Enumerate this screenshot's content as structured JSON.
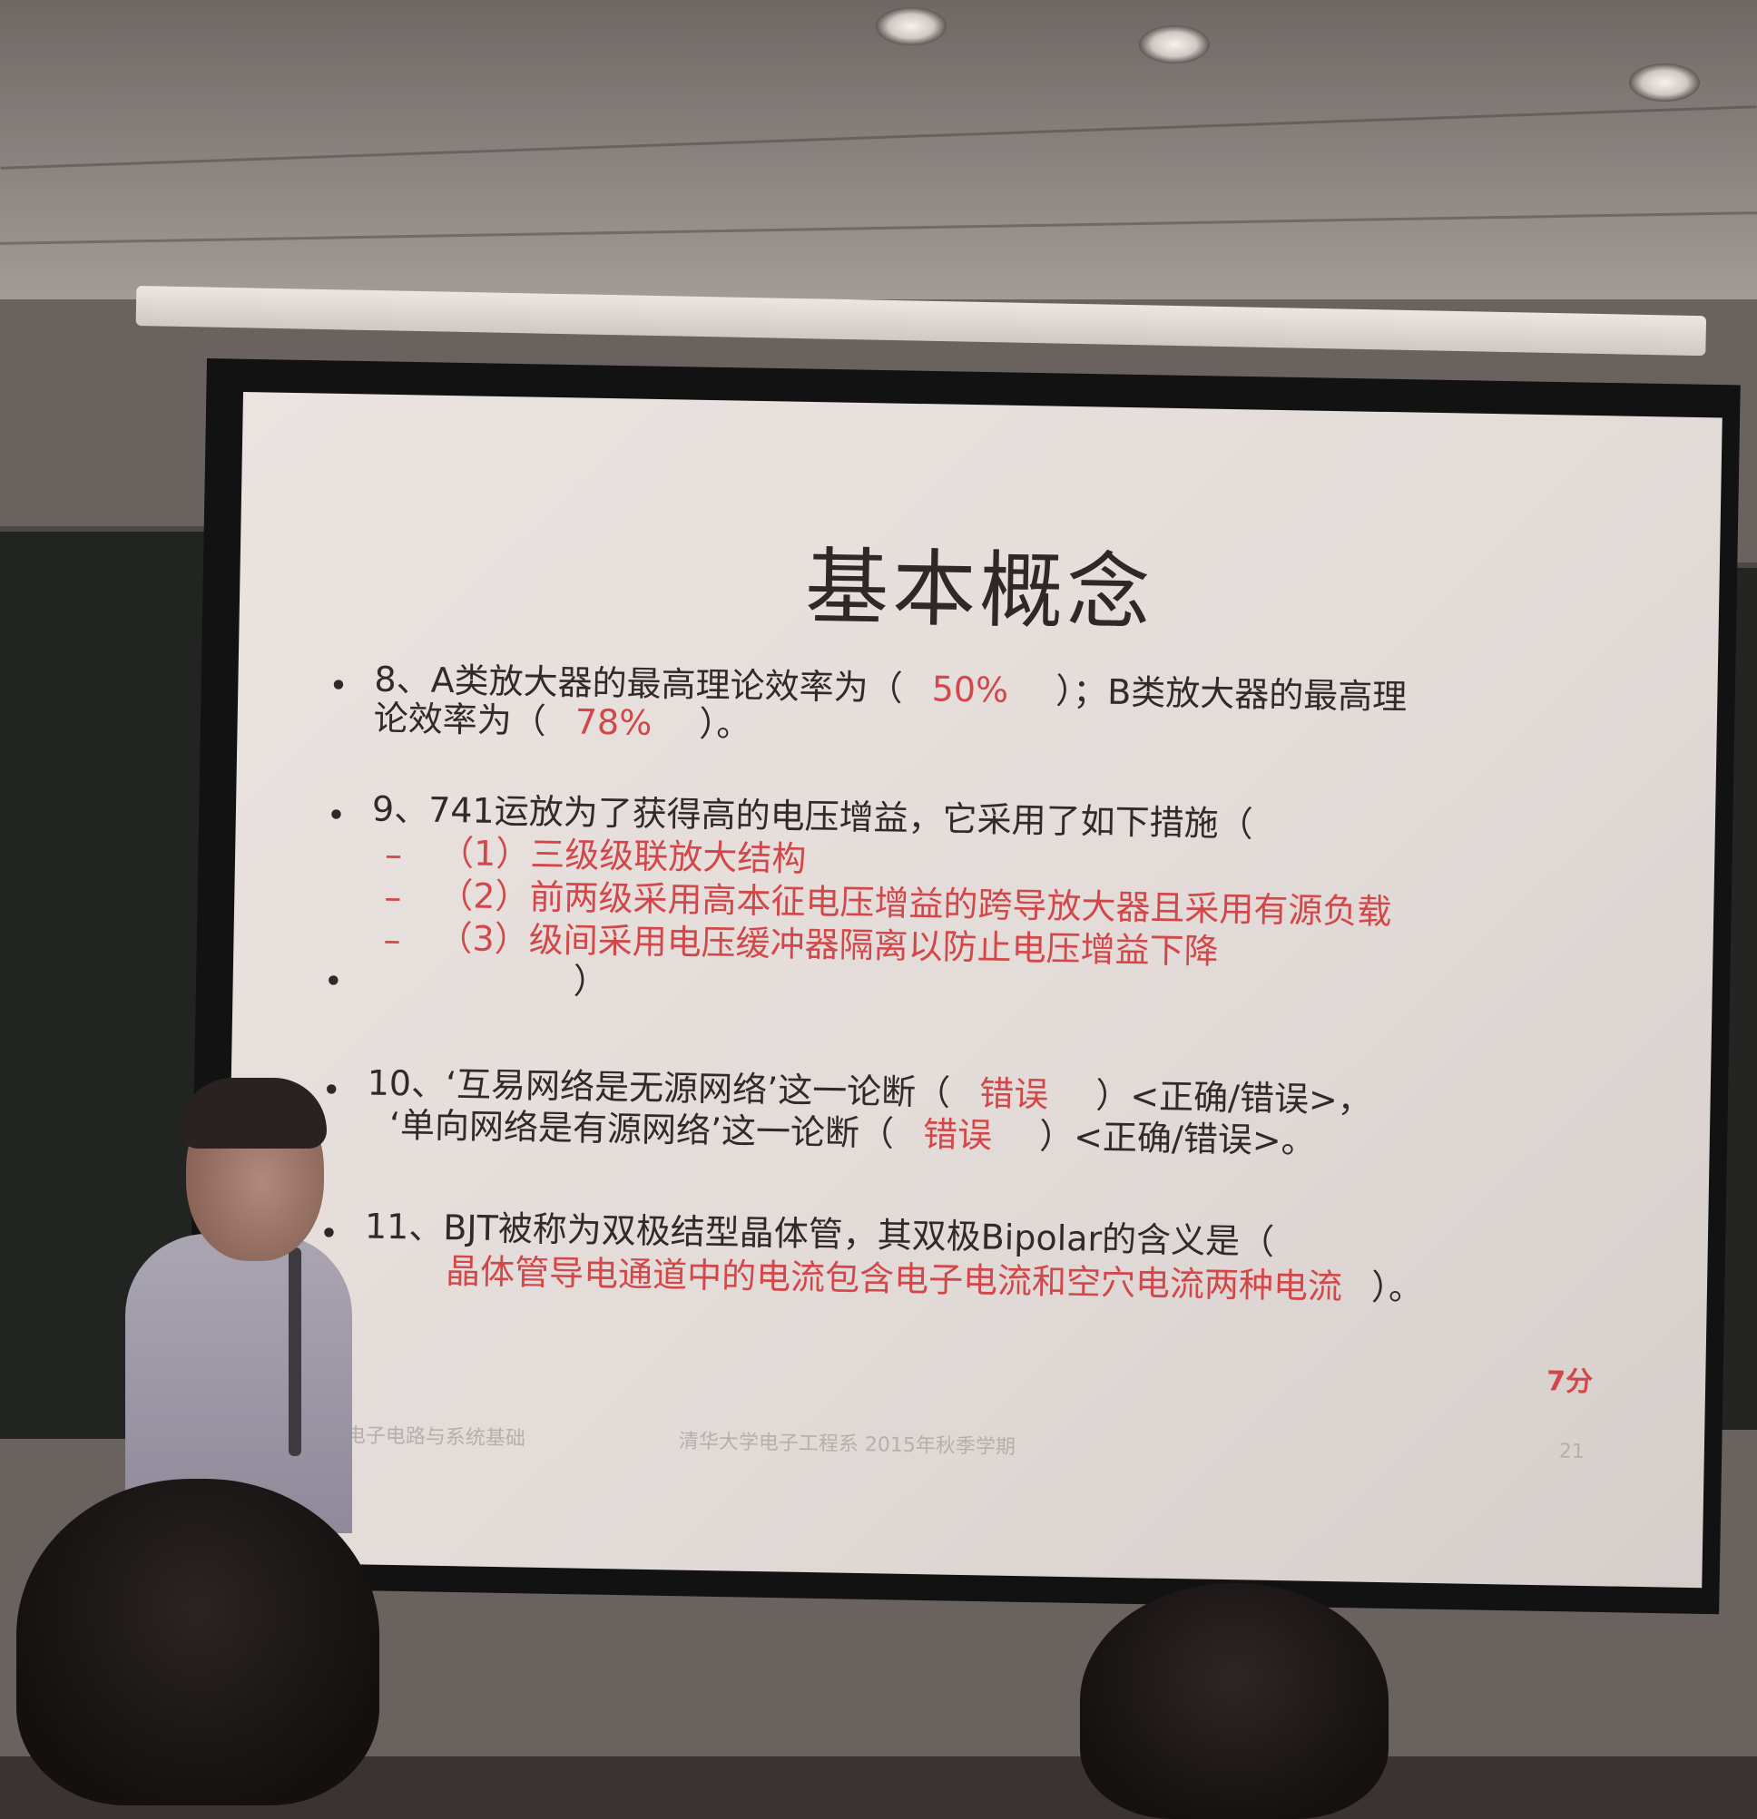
{
  "slide": {
    "title": "基本概念",
    "q8": {
      "line1_a": "8、A类放大器的最高理论效率为（",
      "answer1": "50%",
      "line1_b": "）；B类放大器的最高理",
      "line2_a": "论效率为（",
      "answer2": "78%",
      "line2_b": "）。"
    },
    "q9": {
      "line1": "9、741运放为了获得高的电压增益，它采用了如下措施（",
      "items": [
        "（1）三级级联放大结构",
        "（2）前两级采用高本征电压增益的跨导放大器且采用有源负载",
        "（3）级间采用电压缓冲器隔离以防止电压增益下降"
      ],
      "closing": "）"
    },
    "q10": {
      "line1_a": "10、‘互易网络是无源网络’这一论断（",
      "answer1": "错误",
      "line1_b": "）<正确/错误>，",
      "line2_a": "‘单向网络是有源网络’这一论断（",
      "answer2": "错误",
      "line2_b": "）<正确/错误>。"
    },
    "q11": {
      "line1": "11、BJT被称为双极结型晶体管，其双极Bipolar的含义是（",
      "answer": "晶体管导电通道中的电流包含电子电流和空穴电流两种电流",
      "line2_b": "）。"
    },
    "score": "7分",
    "footer": {
      "left": "李国林 电子电路与系统基础",
      "center": "清华大学电子工程系 2015年秋季学期",
      "page": "21"
    }
  }
}
